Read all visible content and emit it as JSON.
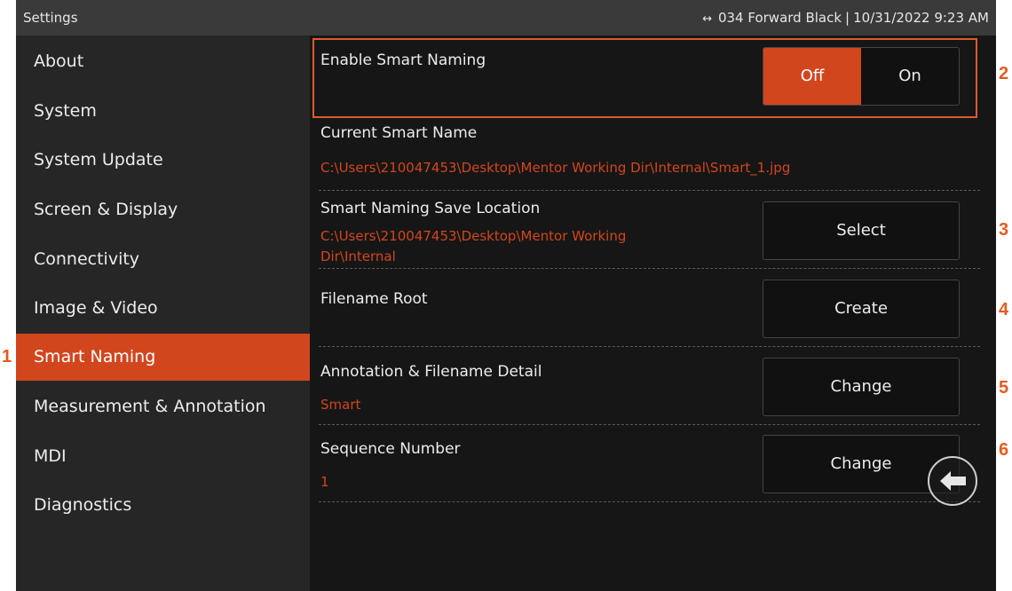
{
  "topbar": {
    "title": "Settings",
    "status_icon": "↔",
    "device": "034 Forward Black",
    "datetime": "10/31/2022  9:23 AM"
  },
  "sidebar": {
    "items": [
      {
        "label": "About"
      },
      {
        "label": "System"
      },
      {
        "label": "System Update"
      },
      {
        "label": "Screen & Display"
      },
      {
        "label": "Connectivity"
      },
      {
        "label": "Image & Video"
      },
      {
        "label": "Smart Naming",
        "active": true
      },
      {
        "label": "Measurement & Annotation"
      },
      {
        "label": "MDI"
      },
      {
        "label": "Diagnostics"
      }
    ]
  },
  "main": {
    "enable_smart_naming": {
      "label": "Enable Smart Naming",
      "off_label": "Off",
      "on_label": "On",
      "selected": "Off"
    },
    "current_smart_name": {
      "label": "Current Smart Name",
      "value": "C:\\Users\\210047453\\Desktop\\Mentor Working Dir\\Internal\\Smart_1.jpg"
    },
    "save_location": {
      "label": "Smart Naming Save Location",
      "value_line1": "C:\\Users\\210047453\\Desktop\\Mentor Working",
      "value_line2": "Dir\\Internal",
      "button": "Select"
    },
    "filename_root": {
      "label": "Filename Root",
      "button": "Create"
    },
    "annotation_detail": {
      "label": "Annotation & Filename Detail",
      "value": "Smart",
      "button": "Change"
    },
    "sequence_number": {
      "label": "Sequence Number",
      "value": "1",
      "button": "Change"
    }
  },
  "callouts": [
    "1",
    "2",
    "3",
    "4",
    "5",
    "6"
  ],
  "icons": {
    "back": "back-arrow-icon"
  },
  "colors": {
    "accent": "#d2461e",
    "callout": "#e65a1e",
    "background": "#161616",
    "sidebar": "#262626",
    "topbar": "#3a3a3a"
  }
}
